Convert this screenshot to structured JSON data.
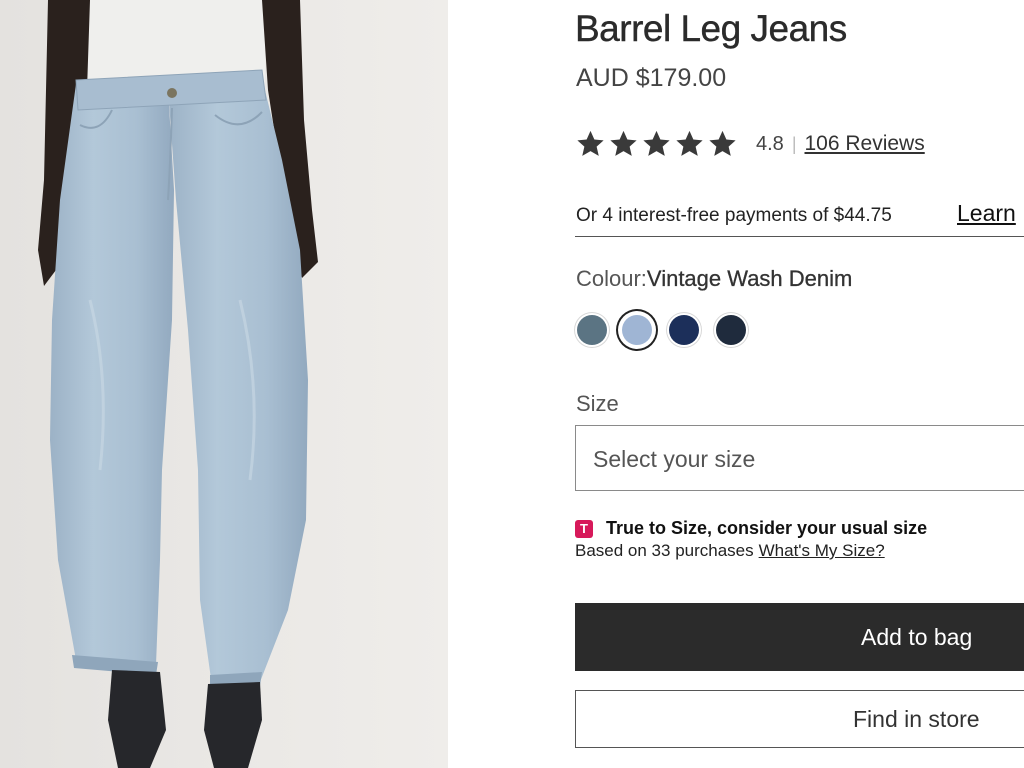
{
  "product": {
    "title": "Barrel Leg Jeans",
    "price": "AUD $179.00",
    "image": {
      "name": "barrel-leg-jeans-photo",
      "alt": "Model wearing light blue barrel leg jeans"
    }
  },
  "rating": {
    "value": "4.8",
    "separator": "|",
    "reviews_label": "106 Reviews",
    "stars": 5,
    "star_icon": "star-icon",
    "star_color": "#3a3a3a"
  },
  "payments": {
    "text": "Or 4 interest-free payments of $44.75",
    "learn_label": "Learn"
  },
  "colour": {
    "label": "Colour:",
    "selected": "Vintage Wash Denim",
    "swatches": [
      {
        "name": "slate-blue",
        "color": "#5b7483"
      },
      {
        "name": "vintage-wash",
        "color": "#9fb5d4",
        "selected": true
      },
      {
        "name": "dark-navy",
        "color": "#1c2f5a"
      },
      {
        "name": "midnight",
        "color": "#1f2b3d"
      }
    ]
  },
  "size": {
    "label": "Size",
    "placeholder": "Select your size"
  },
  "fit": {
    "logo_letter": "T",
    "logo_color": "#d7195a",
    "heading": "True to Size, consider your usual size",
    "based_on": "Based on 33 purchases",
    "link": "What's My Size?"
  },
  "actions": {
    "add_to_bag": "Add to bag",
    "find_in_store": "Find in store",
    "primary_color": "#2b2b2b"
  }
}
